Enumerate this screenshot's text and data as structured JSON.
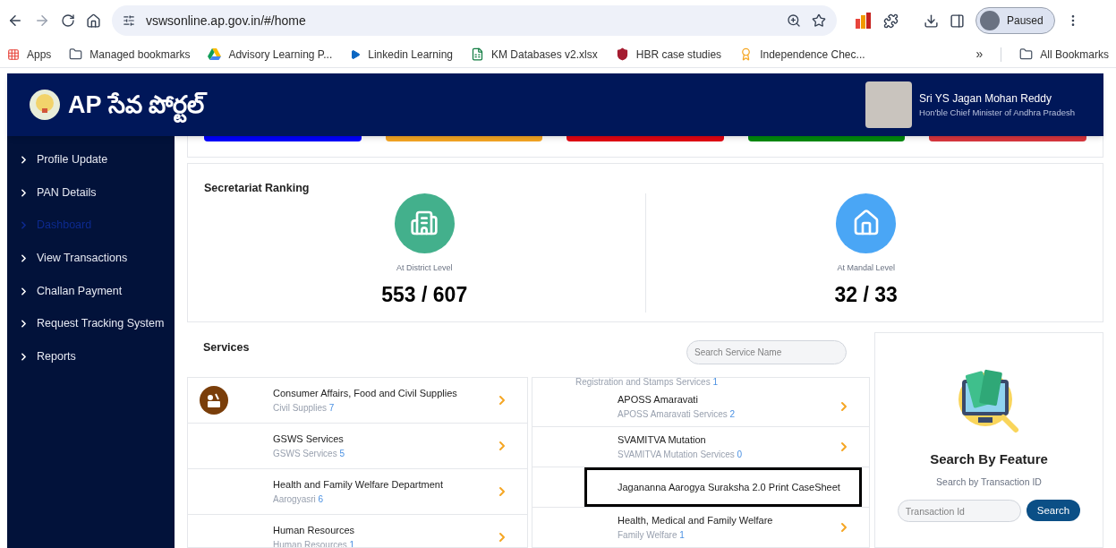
{
  "browser": {
    "url": "vswsonline.ap.gov.in/#/home",
    "profile_label": "Paused",
    "bookmarks": [
      {
        "label": "Apps"
      },
      {
        "label": "Managed bookmarks"
      },
      {
        "label": "Advisory Learning P..."
      },
      {
        "label": "Linkedin Learning"
      },
      {
        "label": "KM Databases v2.xlsx"
      },
      {
        "label": "HBR case studies"
      },
      {
        "label": "Independence Chec..."
      }
    ],
    "overflow": "»",
    "all_bookmarks": "All Bookmarks"
  },
  "header": {
    "title": "AP సేవ పోర్టల్",
    "leader_name": "Sri YS Jagan Mohan Reddy",
    "leader_title": "Hon'ble Chief Minister of Andhra Pradesh"
  },
  "sidebar": {
    "items": [
      {
        "label": "Profile Update",
        "selected": false
      },
      {
        "label": "PAN Details",
        "selected": false
      },
      {
        "label": "Dashboard",
        "selected": true
      },
      {
        "label": "View Transactions",
        "selected": false
      },
      {
        "label": "Challan Payment",
        "selected": false
      },
      {
        "label": "Request Tracking System",
        "selected": false
      },
      {
        "label": "Reports",
        "selected": false
      }
    ]
  },
  "tiles": [
    {
      "color": "#0000ff"
    },
    {
      "color": "#f5a623"
    },
    {
      "color": "#e30613"
    },
    {
      "color": "#008a0e"
    },
    {
      "color": "#d9363e"
    }
  ],
  "ranking": {
    "title": "Secretariat Ranking",
    "items": [
      {
        "kind": "district",
        "label": "At District Level",
        "value": "553 / 607"
      },
      {
        "kind": "mandal",
        "label": "At Mandal Level",
        "value": "32 / 33"
      }
    ]
  },
  "services": {
    "title": "Services",
    "search_placeholder": "Search Service Name",
    "left": [
      {
        "name": "Consumer Affairs, Food and Civil Supplies",
        "sub": "Civil Supplies",
        "count": "7",
        "icon": true,
        "highlighted": false
      },
      {
        "name": "GSWS Services",
        "sub": "GSWS Services",
        "count": "5",
        "icon": false,
        "highlighted": false
      },
      {
        "name": "Health and Family Welfare Department",
        "sub": "Aarogyasri",
        "count": "6",
        "icon": false,
        "highlighted": false
      },
      {
        "name": "Human Resources",
        "sub": "Human Resources",
        "count": "1",
        "icon": false,
        "highlighted": false
      }
    ],
    "right": [
      {
        "sub": "Registration and Stamps Services",
        "count": "1"
      },
      {
        "name": "APOSS Amaravati",
        "sub": "APOSS Amaravati Services",
        "count": "2",
        "icon": false,
        "highlighted": false
      },
      {
        "name": "SVAMITVA Mutation",
        "sub": "SVAMITVA Mutation Services",
        "count": "0",
        "icon": false,
        "highlighted": false
      },
      {
        "name": "Jagananna Aarogya Suraksha 2.0 Print CaseSheet",
        "icon": false,
        "highlighted": true
      },
      {
        "name": "Health, Medical and Family Welfare",
        "sub": "Family Welfare",
        "count": "1",
        "icon": false,
        "highlighted": false
      }
    ]
  },
  "feature": {
    "title": "Search By Feature",
    "subtitle": "Search by Transaction ID",
    "input_placeholder": "Transaction Id",
    "button": "Search"
  }
}
